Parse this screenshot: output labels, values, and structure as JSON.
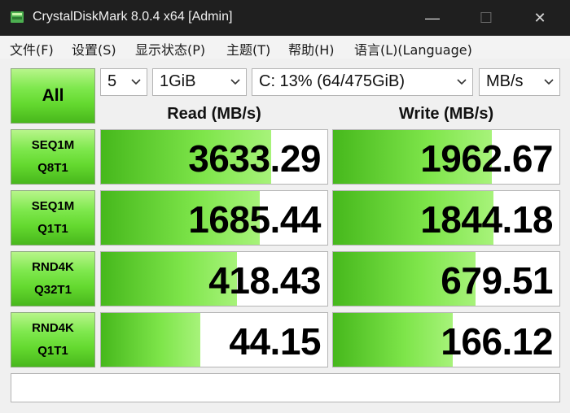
{
  "window": {
    "title": "CrystalDiskMark 8.0.4 x64 [Admin]",
    "minimize": "—",
    "maximize": "☐",
    "close": "✕"
  },
  "menu": [
    "文件(F)",
    "设置(S)",
    "显示状态(P)",
    "主题(T)",
    "帮助(H)",
    "语言(L)(Language)"
  ],
  "controls": {
    "all_label": "All",
    "count": "5",
    "size": "1GiB",
    "drive": "C: 13% (64/475GiB)",
    "unit": "MB/s"
  },
  "headers": {
    "read": "Read (MB/s)",
    "write": "Write (MB/s)"
  },
  "tests": [
    {
      "line1": "SEQ1M",
      "line2": "Q8T1",
      "read": "3633.29",
      "write": "1962.67",
      "read_fill_pct": 75,
      "write_fill_pct": 70
    },
    {
      "line1": "SEQ1M",
      "line2": "Q1T1",
      "read": "1685.44",
      "write": "1844.18",
      "read_fill_pct": 70,
      "write_fill_pct": 71
    },
    {
      "line1": "RND4K",
      "line2": "Q32T1",
      "read": "418.43",
      "write": "679.51",
      "read_fill_pct": 60,
      "write_fill_pct": 63
    },
    {
      "line1": "RND4K",
      "line2": "Q1T1",
      "read": "44.15",
      "write": "166.12",
      "read_fill_pct": 44,
      "write_fill_pct": 53
    }
  ],
  "status": "",
  "colors": {
    "title_bg": "#1f1f1f",
    "client_bg": "#f0f0f0",
    "green_dark": "#46b81c",
    "green_light": "#a7f37a"
  }
}
